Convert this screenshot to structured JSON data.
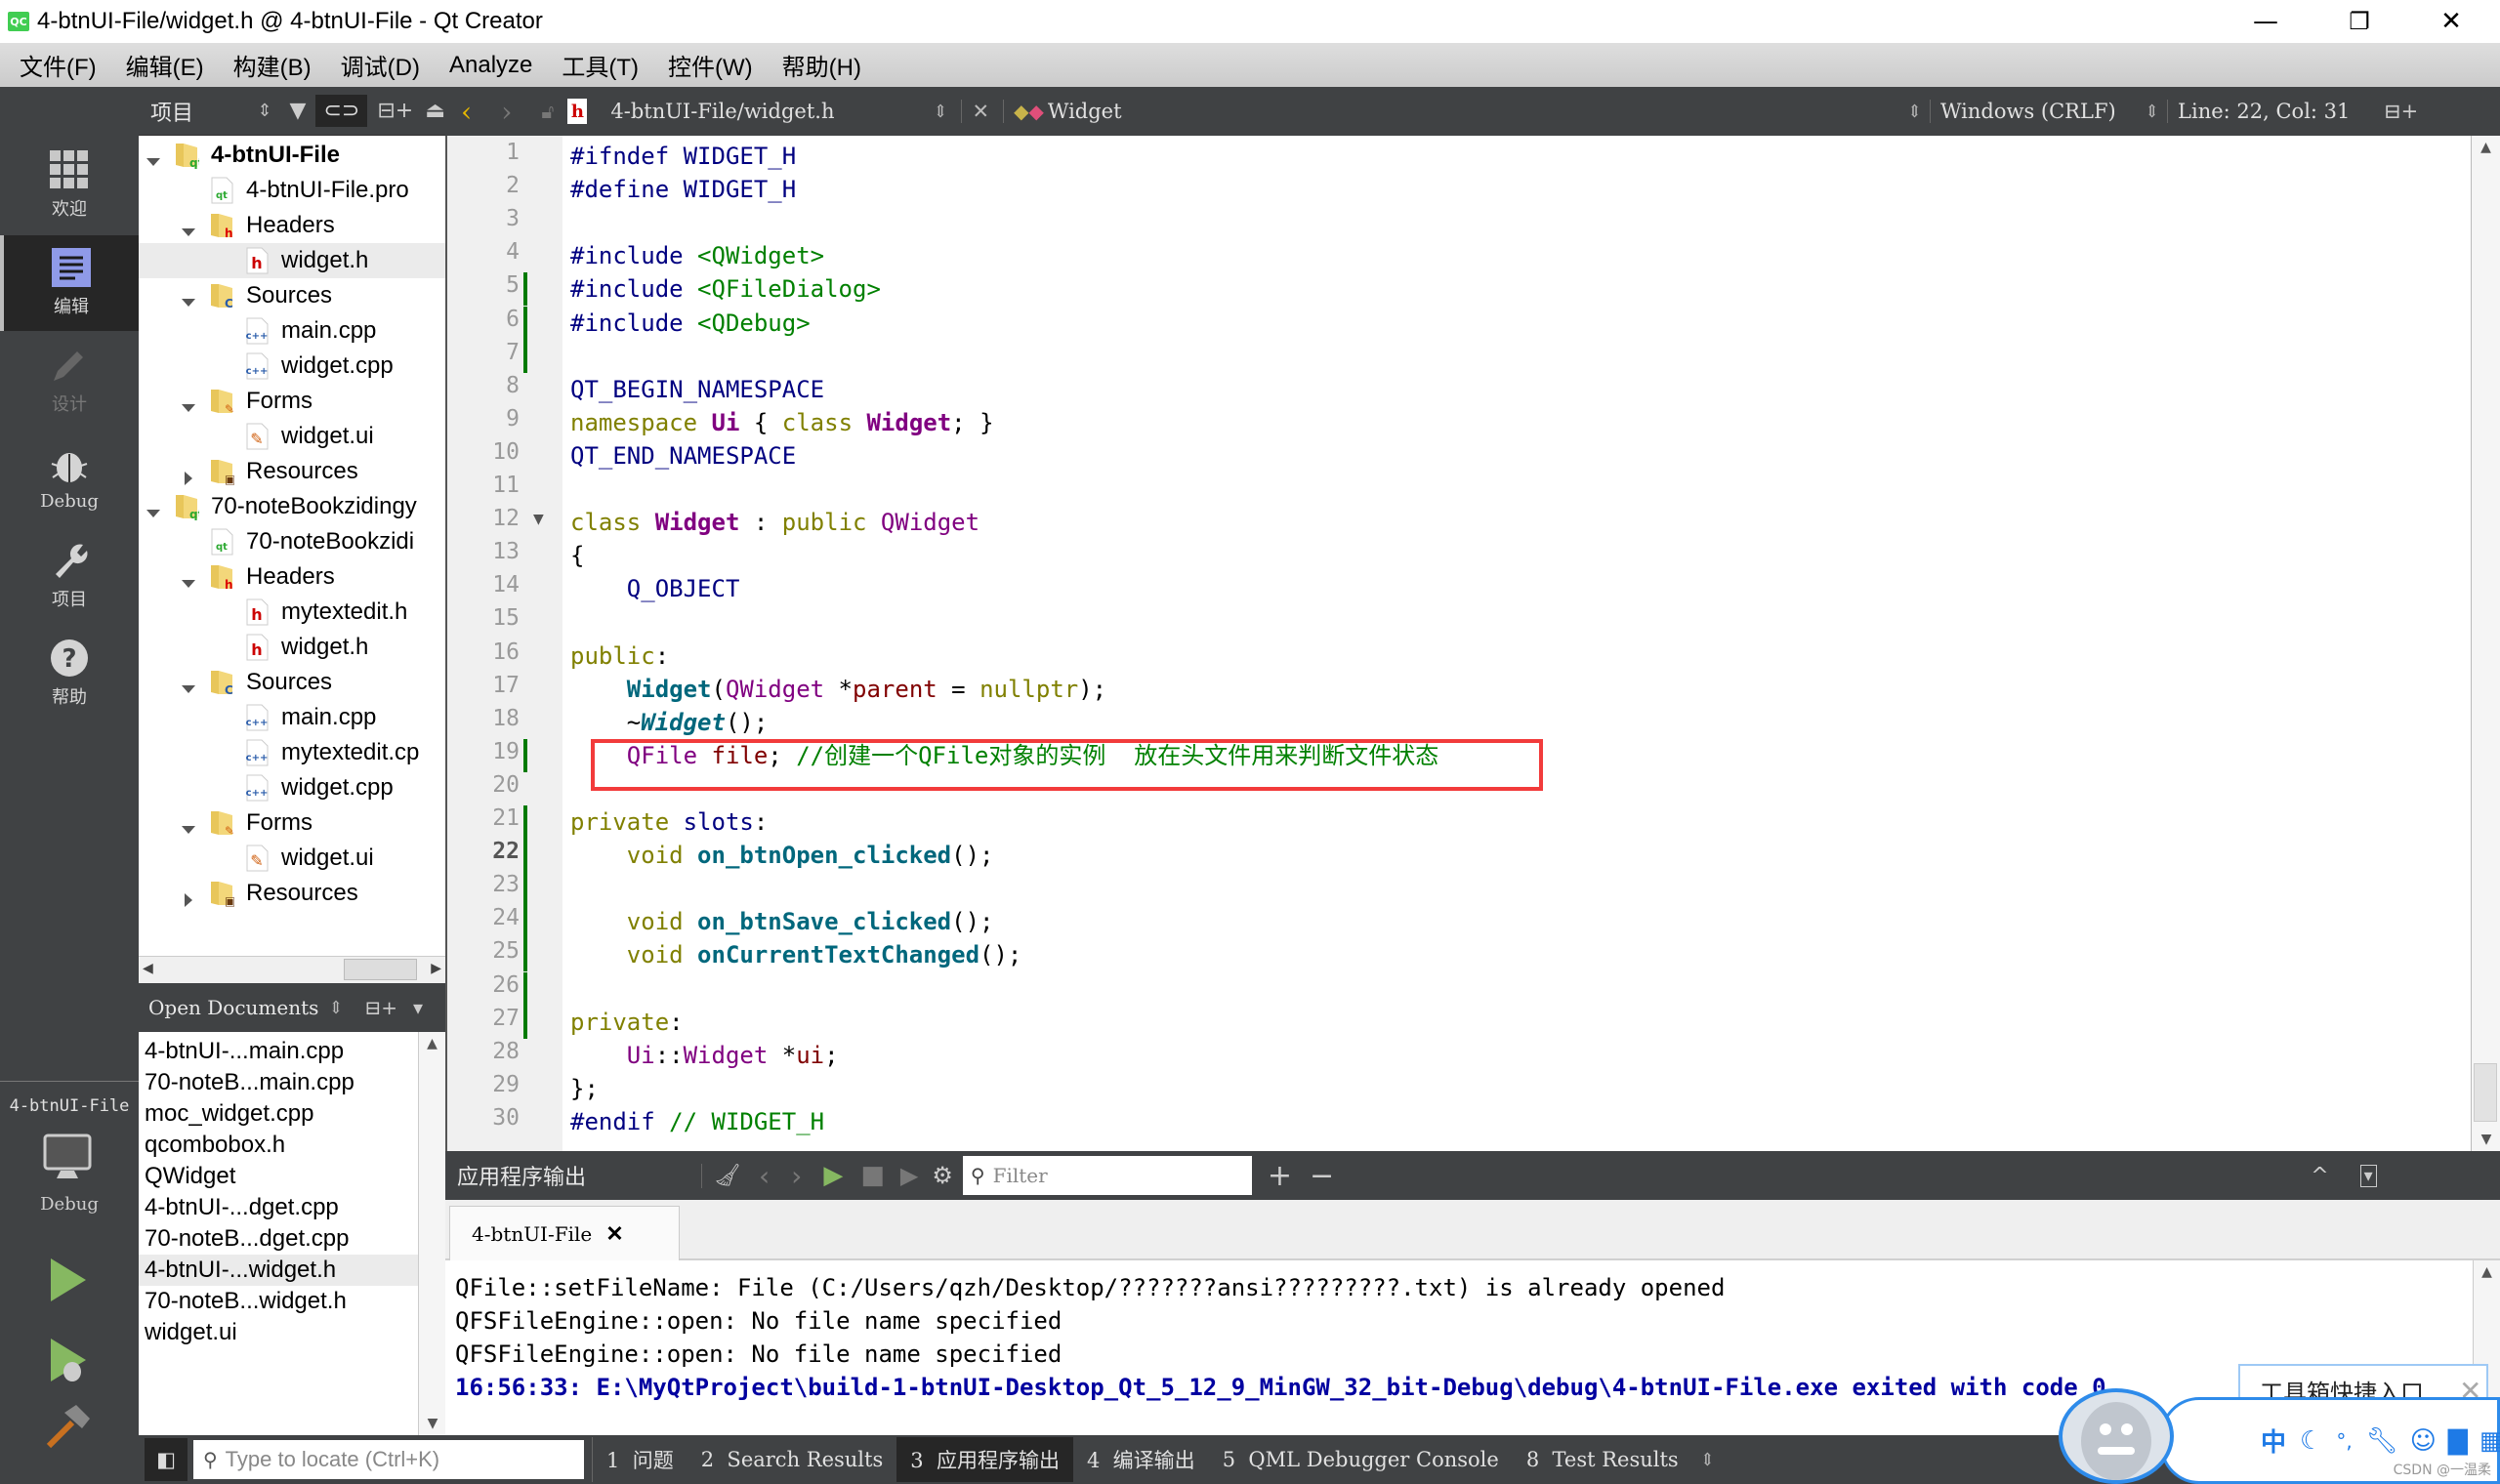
{
  "window": {
    "title": "4-btnUI-File/widget.h @ 4-btnUI-File - Qt Creator",
    "app_icon_label": "QC",
    "minimize": "—",
    "restore": "❐",
    "close": "✕"
  },
  "menu": [
    "文件(F)",
    "编辑(E)",
    "构建(B)",
    "调试(D)",
    "Analyze",
    "工具(T)",
    "控件(W)",
    "帮助(H)"
  ],
  "modes": [
    {
      "label": "欢迎",
      "icon": "grid-icon",
      "state": "normal"
    },
    {
      "label": "编辑",
      "icon": "edit-document-icon",
      "state": "active"
    },
    {
      "label": "设计",
      "icon": "pencil-icon",
      "state": "disabled"
    },
    {
      "label": "Debug",
      "icon": "bug-icon",
      "state": "normal"
    },
    {
      "label": "项目",
      "icon": "wrench-icon",
      "state": "normal"
    },
    {
      "label": "帮助",
      "icon": "help-icon",
      "state": "normal"
    }
  ],
  "kit": {
    "project": "4-btnUI-File",
    "config": "Debug"
  },
  "project_panel": {
    "title": "项目",
    "tree": [
      {
        "label": "4-btnUI-File",
        "level": 0,
        "expander": "open",
        "icon": "qt-project-folder",
        "bold": true
      },
      {
        "label": "4-btnUI-File.pro",
        "level": 1,
        "expander": "none",
        "icon": "pro-file"
      },
      {
        "label": "Headers",
        "level": 1,
        "expander": "open",
        "icon": "headers-folder"
      },
      {
        "label": "widget.h",
        "level": 2,
        "expander": "none",
        "icon": "header-file",
        "selected": true
      },
      {
        "label": "Sources",
        "level": 1,
        "expander": "open",
        "icon": "sources-folder"
      },
      {
        "label": "main.cpp",
        "level": 2,
        "expander": "none",
        "icon": "cpp-file"
      },
      {
        "label": "widget.cpp",
        "level": 2,
        "expander": "none",
        "icon": "cpp-file"
      },
      {
        "label": "Forms",
        "level": 1,
        "expander": "open",
        "icon": "forms-folder"
      },
      {
        "label": "widget.ui",
        "level": 2,
        "expander": "none",
        "icon": "ui-file"
      },
      {
        "label": "Resources",
        "level": 1,
        "expander": "closed",
        "icon": "resources-folder"
      },
      {
        "label": "70-noteBookzidingy",
        "level": 0,
        "expander": "open",
        "icon": "qt-project-folder"
      },
      {
        "label": "70-noteBookzidi",
        "level": 1,
        "expander": "none",
        "icon": "pro-file"
      },
      {
        "label": "Headers",
        "level": 1,
        "expander": "open",
        "icon": "headers-folder"
      },
      {
        "label": "mytextedit.h",
        "level": 2,
        "expander": "none",
        "icon": "header-file"
      },
      {
        "label": "widget.h",
        "level": 2,
        "expander": "none",
        "icon": "header-file"
      },
      {
        "label": "Sources",
        "level": 1,
        "expander": "open",
        "icon": "sources-folder"
      },
      {
        "label": "main.cpp",
        "level": 2,
        "expander": "none",
        "icon": "cpp-file"
      },
      {
        "label": "mytextedit.cp",
        "level": 2,
        "expander": "none",
        "icon": "cpp-file"
      },
      {
        "label": "widget.cpp",
        "level": 2,
        "expander": "none",
        "icon": "cpp-file"
      },
      {
        "label": "Forms",
        "level": 1,
        "expander": "open",
        "icon": "forms-folder"
      },
      {
        "label": "widget.ui",
        "level": 2,
        "expander": "none",
        "icon": "ui-file"
      },
      {
        "label": "Resources",
        "level": 1,
        "expander": "closed",
        "icon": "resources-folder"
      }
    ]
  },
  "open_documents": {
    "title": "Open Documents",
    "items": [
      {
        "label": "4-btnUI-...main.cpp"
      },
      {
        "label": "70-noteB...main.cpp"
      },
      {
        "label": "moc_widget.cpp"
      },
      {
        "label": "qcombobox.h"
      },
      {
        "label": "QWidget"
      },
      {
        "label": "4-btnUI-...dget.cpp"
      },
      {
        "label": "70-noteB...dget.cpp"
      },
      {
        "label": "4-btnUI-...widget.h",
        "selected": true
      },
      {
        "label": "70-noteB...widget.h"
      },
      {
        "label": "widget.ui"
      }
    ]
  },
  "editor_toolbar": {
    "file": "4-btnUI-File/widget.h",
    "symbol": "Widget",
    "line_ending": "Windows (CRLF)",
    "position": "Line: 22, Col: 31"
  },
  "editor": {
    "current_line": 22,
    "highlighted_line": 19,
    "changed_lines": [
      5,
      6,
      7,
      19,
      21,
      22,
      23,
      24,
      25,
      26,
      27
    ],
    "fold_line": 12,
    "lines": [
      [
        [
          "pp",
          "#ifndef "
        ],
        [
          "mac",
          "WIDGET_H"
        ]
      ],
      [
        [
          "pp",
          "#define "
        ],
        [
          "mac",
          "WIDGET_H"
        ]
      ],
      [],
      [
        [
          "pp",
          "#include "
        ],
        [
          "str",
          "<QWidget>"
        ]
      ],
      [
        [
          "pp",
          "#include "
        ],
        [
          "str",
          "<QFileDialog>"
        ]
      ],
      [
        [
          "pp",
          "#include "
        ],
        [
          "str",
          "<QDebug>"
        ]
      ],
      [],
      [
        [
          "mac",
          "QT_BEGIN_NAMESPACE"
        ]
      ],
      [
        [
          "kw",
          "namespace "
        ],
        [
          "tyb",
          "Ui"
        ],
        [
          "pl",
          " { "
        ],
        [
          "kw",
          "class "
        ],
        [
          "tyb",
          "Widget"
        ],
        [
          "pl",
          "; }"
        ]
      ],
      [
        [
          "mac",
          "QT_END_NAMESPACE"
        ]
      ],
      [],
      [
        [
          "kw",
          "class "
        ],
        [
          "tyb",
          "Widget"
        ],
        [
          "pl",
          " : "
        ],
        [
          "kw",
          "public "
        ],
        [
          "ty",
          "QWidget"
        ]
      ],
      [
        [
          "pl",
          "{"
        ]
      ],
      [
        [
          "pl",
          "    "
        ],
        [
          "mac",
          "Q_OBJECT"
        ]
      ],
      [],
      [
        [
          "kw",
          "public"
        ],
        [
          "pl",
          ":"
        ]
      ],
      [
        [
          "pl",
          "    "
        ],
        [
          "fn",
          "Widget"
        ],
        [
          "pl",
          "("
        ],
        [
          "ty",
          "QWidget"
        ],
        [
          "pl",
          " *"
        ],
        [
          "mem",
          "parent"
        ],
        [
          "pl",
          " = "
        ],
        [
          "kw",
          "nullptr"
        ],
        [
          "pl",
          ");"
        ]
      ],
      [
        [
          "pl",
          "    ~"
        ],
        [
          "fni",
          "Widget"
        ],
        [
          "pl",
          "();"
        ]
      ],
      [
        [
          "pl",
          "    "
        ],
        [
          "ty",
          "QFile"
        ],
        [
          "pl",
          " "
        ],
        [
          "mem",
          "file"
        ],
        [
          "pl",
          "; "
        ],
        [
          "cm",
          "//创建一个QFile对象的实例  放在头文件用来判断文件状态"
        ]
      ],
      [],
      [
        [
          "kw",
          "private "
        ],
        [
          "pp",
          "slots"
        ],
        [
          "pl",
          ":"
        ]
      ],
      [
        [
          "pl",
          "    "
        ],
        [
          "kw",
          "void "
        ],
        [
          "fn",
          "on_btnOpen_clicked"
        ],
        [
          "pl",
          "();"
        ]
      ],
      [],
      [
        [
          "pl",
          "    "
        ],
        [
          "kw",
          "void "
        ],
        [
          "fn",
          "on_btnSave_clicked"
        ],
        [
          "pl",
          "();"
        ]
      ],
      [
        [
          "pl",
          "    "
        ],
        [
          "kw",
          "void "
        ],
        [
          "fn",
          "onCurrentTextChanged"
        ],
        [
          "pl",
          "();"
        ]
      ],
      [],
      [
        [
          "kw",
          "private"
        ],
        [
          "pl",
          ":"
        ]
      ],
      [
        [
          "pl",
          "    "
        ],
        [
          "ty",
          "Ui"
        ],
        [
          "pl",
          "::"
        ],
        [
          "ty",
          "Widget"
        ],
        [
          "pl",
          " *"
        ],
        [
          "mem",
          "ui"
        ],
        [
          "pl",
          ";"
        ]
      ],
      [
        [
          "pl",
          "};"
        ]
      ],
      [
        [
          "pp",
          "#endif "
        ],
        [
          "cm",
          "// WIDGET_H"
        ]
      ]
    ]
  },
  "output_pane": {
    "title": "应用程序输出",
    "filter_placeholder": "Filter",
    "tab": "4-btnUI-File",
    "tab_close": "✕",
    "lines": [
      {
        "text": "QFile::setFileName: File (C:/Users/qzh/Desktop/???????ansi?????????.txt) is already opened",
        "type": "normal"
      },
      {
        "text": "QFSFileEngine::open: No file name specified",
        "type": "normal"
      },
      {
        "text": "QFSFileEngine::open: No file name specified",
        "type": "normal"
      },
      {
        "text": "16:56:33: E:\\MyQtProject\\build-1-btnUI-Desktop_Qt_5_12_9_MinGW_32_bit-Debug\\debug\\4-btnUI-File.exe exited with code 0",
        "type": "exit"
      }
    ]
  },
  "statusbar": {
    "locator_placeholder": "Type to locate (Ctrl+K)",
    "tabs": [
      {
        "label": "1  问题"
      },
      {
        "label": "2  Search Results"
      },
      {
        "label": "3  应用程序输出",
        "active": true
      },
      {
        "label": "4  编译输出"
      },
      {
        "label": "5  QML Debugger Console"
      },
      {
        "label": "8  Test Results"
      }
    ]
  },
  "ime": {
    "tooltip": "工具箱快捷入口",
    "tooltip_close": "✕",
    "mode_char": "中",
    "icons": [
      "moon-icon",
      "punctuation-icon",
      "wrench-icon",
      "smiley-icon",
      "shirt-icon",
      "grid-icon",
      "lock-icon"
    ],
    "watermark": "CSDN @一温柔"
  }
}
